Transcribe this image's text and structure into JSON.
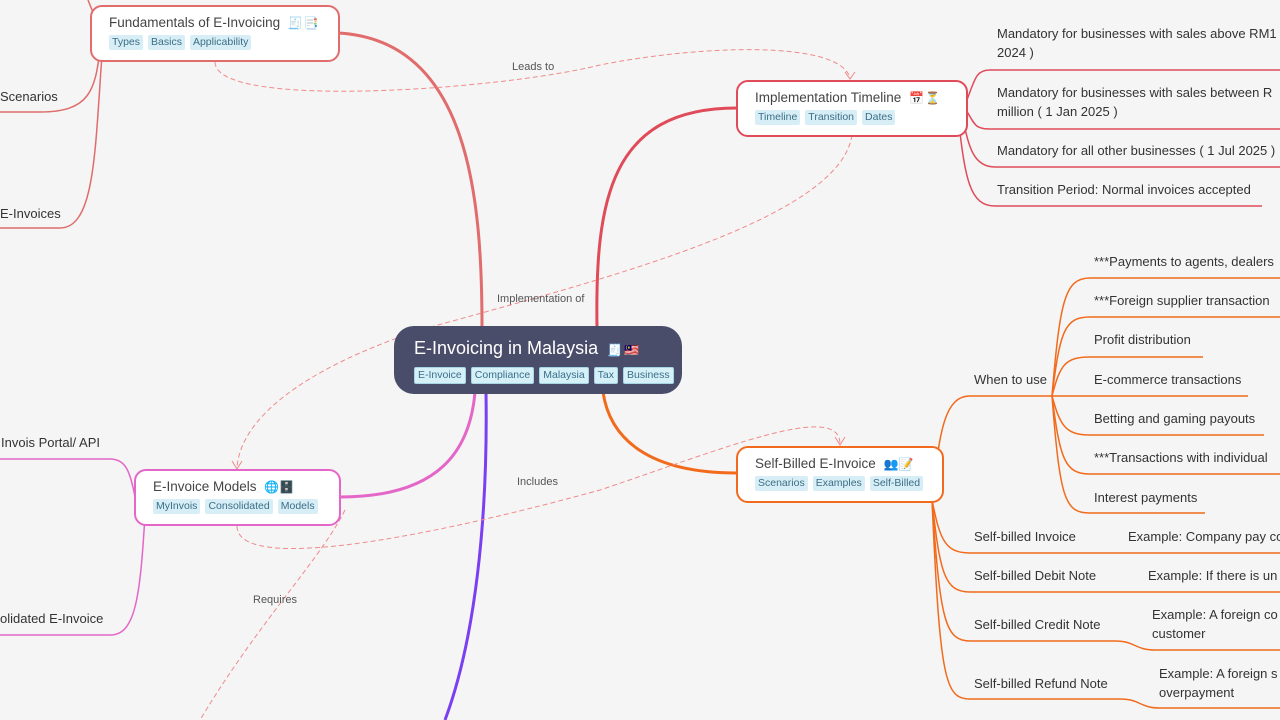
{
  "root": {
    "title": "E-Invoicing in Malaysia",
    "icons": [
      "receipt-icon",
      "malaysia-flag-icon"
    ],
    "tags": [
      "E-Invoice",
      "Compliance",
      "Malaysia",
      "Tax",
      "Business"
    ]
  },
  "colors": {
    "background": "#f5f5f5",
    "root_fill": "#4a4d69",
    "fundamentals": "#e06c6c",
    "timeline": "#e04b5a",
    "self_billed": "#f26b1d",
    "models": "#e466c8",
    "bottom_branch": "#7b3ff2",
    "relation": "#f08a8a"
  },
  "branches": {
    "fundamentals": {
      "title": "Fundamentals of E-Invoicing",
      "icons": [
        "receipt-icon",
        "bookmark-tabs-icon"
      ],
      "tags": [
        "Types",
        "Basics",
        "Applicability"
      ],
      "children": [
        "Scenarios",
        "E-Invoices"
      ]
    },
    "timeline": {
      "title": "Implementation Timeline",
      "icons": [
        "calendar-icon",
        "hourglass-icon"
      ],
      "tags": [
        "Timeline",
        "Transition",
        "Dates"
      ],
      "children": [
        "Mandatory for businesses with sales above RM1",
        "2024 )",
        "Mandatory for businesses with sales between R",
        "million ( 1 Jan 2025 )",
        "Mandatory for all other businesses ( 1 Jul 2025 )",
        "Transition Period: Normal invoices accepted"
      ]
    },
    "self_billed": {
      "title": "Self-Billed E-Invoice",
      "icons": [
        "people-icon",
        "memo-icon"
      ],
      "tags": [
        "Scenarios",
        "Examples",
        "Self-Billed"
      ],
      "when_to_use": {
        "label": "When to use",
        "items": [
          "***Payments to agents, dealers",
          "***Foreign supplier transaction",
          "Profit distribution",
          "E-commerce transactions",
          "Betting and gaming payouts",
          "***Transactions with individual",
          "Interest payments"
        ]
      },
      "types": [
        {
          "label": "Self-billed Invoice",
          "example": [
            "Example: Company pay co"
          ]
        },
        {
          "label": "Self-billed Debit Note",
          "example": [
            "Example: If there is un"
          ]
        },
        {
          "label": "Self-billed Credit Note",
          "example": [
            "Example: A foreign co",
            "customer"
          ]
        },
        {
          "label": "Self-billed Refund Note",
          "example": [
            "Example: A foreign s",
            "overpayment"
          ]
        }
      ]
    },
    "models": {
      "title": "E-Invoice Models",
      "icons": [
        "globe-icon",
        "file-cabinet-icon"
      ],
      "tags": [
        "MyInvois",
        "Consolidated",
        "Models"
      ],
      "children": [
        "Invois Portal/ API",
        "olidated E-Invoice"
      ]
    }
  },
  "relations": [
    {
      "label": "Leads to"
    },
    {
      "label": "Implementation of"
    },
    {
      "label": "Includes"
    },
    {
      "label": "Requires"
    }
  ]
}
